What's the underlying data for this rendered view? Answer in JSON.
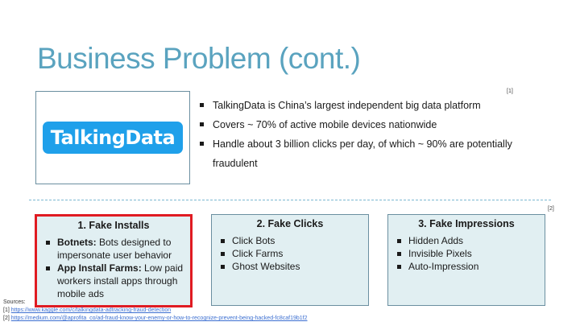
{
  "slide": {
    "title": "Business Problem (cont.)",
    "logo_text": "TalkingData",
    "bullets": [
      "TalkingData is China’s largest independent big data platform",
      "Covers ~ 70% of active mobile devices nationwide",
      "Handle about 3 billion clicks per day, of which ~ 90% are potentially",
      "fraudulent"
    ],
    "ref1": "[1]",
    "ref2": "[2]"
  },
  "cards": {
    "installs": {
      "title": "1.    Fake Installs",
      "item1_bold": "Botnets:",
      "item1_text": " Bots designed to impersonate user behavior",
      "item2_bold": "App Install Farms:",
      "item2_text": " Low paid workers install apps through mobile ads"
    },
    "clicks": {
      "title": "2. Fake Clicks",
      "items": [
        "Click Bots",
        "Click Farms",
        "Ghost Websites"
      ]
    },
    "impressions": {
      "title": "3. Fake Impressions",
      "items": [
        "Hidden Adds",
        "Invisible Pixels",
        "Auto-Impression"
      ]
    }
  },
  "sources": {
    "label": "Sources:",
    "s1_prefix": "[1] ",
    "s1_link": "https://www.kaggle.com/c/talkingdata-adtracking-fraud-detection",
    "s2_prefix": "[2] ",
    "s2_link": "https://medium.com/@aprofita_co/ad-fraud-know-your-enemy-or-how-to-recognize-prevent-being-hacked-fc8caf19b1f2"
  },
  "colors": {
    "title": "#5aa3bf",
    "card_bg": "#e1eff2",
    "highlight_border": "#e01b22",
    "logo_bg": "#1fa0ea"
  }
}
